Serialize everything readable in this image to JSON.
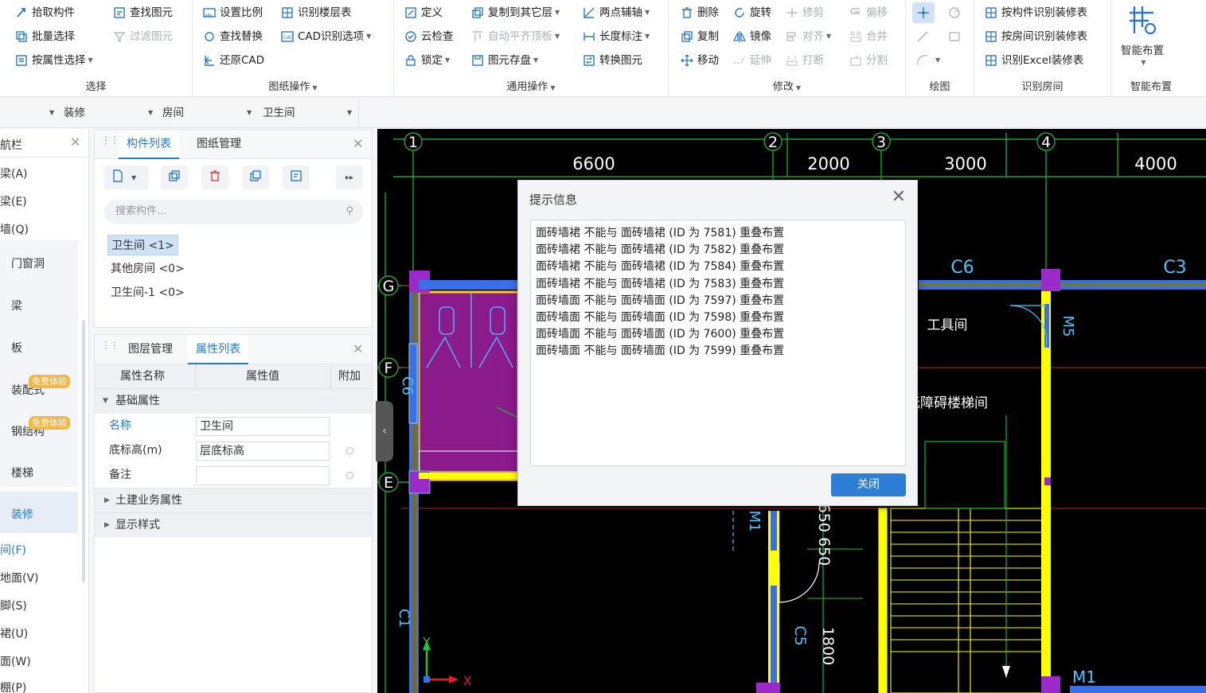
{
  "ribbon": {
    "select": {
      "title": "选择",
      "pick": "拾取构件",
      "batch": "批量选择",
      "by_attr": "按属性选择",
      "find": "查找图元",
      "filter": "过滤图元"
    },
    "drawing_ops": {
      "title": "图纸操作",
      "scale": "设置比例",
      "recognize_floors": "识别楼层表",
      "find_replace": "查找替换",
      "cad_options": "CAD识别选项",
      "restore_cad": "还原CAD"
    },
    "common_ops": {
      "title": "通用操作",
      "define": "定义",
      "copy_to_floor": "复制到其它层",
      "two_point_axis": "两点辅轴",
      "cloud_check": "云检查",
      "auto_align_top": "自动平齐顶板",
      "length_dim": "长度标注",
      "lock": "锁定",
      "save_elements": "图元存盘",
      "convert": "转换图元"
    },
    "modify": {
      "title": "修改",
      "delete": "删除",
      "rotate": "旋转",
      "trim": "修剪",
      "offset": "偏移",
      "copy": "复制",
      "mirror": "镜像",
      "align": "对齐",
      "merge": "合并",
      "move": "移动",
      "extend": "延伸",
      "break": "打断",
      "split": "分割"
    },
    "draw": {
      "title": "绘图"
    },
    "recognize_rooms": {
      "title": "识别房间",
      "by_component": "按构件识别装修表",
      "by_room": "按房间识别装修表",
      "by_excel": "识别Excel装修表"
    },
    "smart": {
      "title": "智能布置",
      "button": "智能布置"
    }
  },
  "filters": {
    "c1": "装修",
    "c2": "房间",
    "c3": "卫生间"
  },
  "nav": {
    "header": "航栏",
    "items": [
      "梁(A)",
      "梁(E)",
      "墙(Q)",
      "门窗洞",
      "梁",
      "板",
      "装配式",
      "钢结构",
      "楼梯",
      "装修",
      "间(F)",
      "地面(V)",
      "脚(S)",
      "裙(U)",
      "面(W)",
      "棚(P)"
    ],
    "badge": "免费体验"
  },
  "comp_panel": {
    "tab1": "构件列表",
    "tab2": "图纸管理",
    "search_placeholder": "搜索构件...",
    "items": [
      "卫生间 <1>",
      "其他房间 <0>",
      "卫生间-1 <0>"
    ]
  },
  "prop_panel": {
    "tab1": "图层管理",
    "tab2": "属性列表",
    "col_name": "属性名称",
    "col_value": "属性值",
    "col_extra": "附加",
    "group_basic": "基础属性",
    "rows": [
      {
        "name": "名称",
        "value": "卫生间"
      },
      {
        "name": "底标高(m)",
        "value": "层底标高"
      },
      {
        "name": "备注",
        "value": ""
      }
    ],
    "group_civil": "土建业务属性",
    "group_display": "显示样式"
  },
  "canvas": {
    "axis_top": [
      "1",
      "2",
      "3",
      "4"
    ],
    "axis_left": [
      "G",
      "F",
      "E"
    ],
    "dims": [
      "6600",
      "2000",
      "3000",
      "4000"
    ],
    "labels": {
      "c6": "C6",
      "c3": "C3",
      "tool_room": "工具间",
      "m5": "M5",
      "stair": "无障碍楼梯间",
      "c6v": "C6",
      "c1": "C1",
      "m1v": "M1",
      "c5": "C5",
      "d650": "650 650",
      "d1800": "1800",
      "m1": "M1",
      "y": "Y",
      "x": "X"
    }
  },
  "dialog": {
    "title": "提示信息",
    "messages": [
      "面砖墙裙 不能与 面砖墙裙 (ID 为 7581) 重叠布置",
      "面砖墙裙 不能与 面砖墙裙 (ID 为 7582) 重叠布置",
      "面砖墙裙 不能与 面砖墙裙 (ID 为 7584) 重叠布置",
      "面砖墙裙 不能与 面砖墙裙 (ID 为 7583) 重叠布置",
      "面砖墙面 不能与 面砖墙面 (ID 为 7597) 重叠布置",
      "面砖墙面 不能与 面砖墙面 (ID 为 7598) 重叠布置",
      "面砖墙面 不能与 面砖墙面 (ID 为 7600) 重叠布置",
      "面砖墙面 不能与 面砖墙面 (ID 为 7599) 重叠布置"
    ],
    "close_label": "关闭"
  },
  "colors": {
    "accent": "#2b79c9",
    "button": "#2d7fd6",
    "cad_green": "#1fbf3a",
    "cad_purple": "#8b1a8b",
    "cad_yellow": "#ffff00",
    "cad_blue": "#3a6fe6"
  }
}
